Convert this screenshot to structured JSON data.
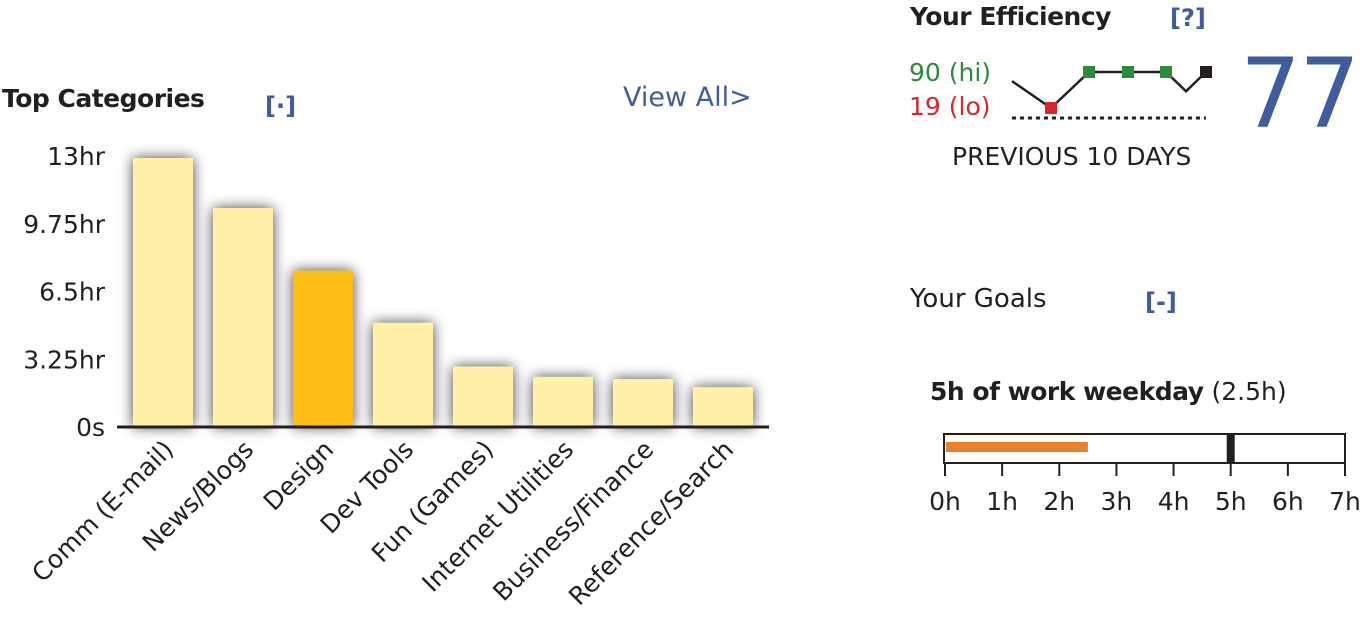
{
  "top_categories": {
    "title": "Top Categories",
    "toggle_label": "[·]",
    "view_all_label": "View All>"
  },
  "efficiency": {
    "title": "Your Efficiency",
    "help_label": "[?]",
    "hi_label": "90 (hi)",
    "lo_label": "19 (lo)",
    "period_label": "PREVIOUS 10 DAYS",
    "score": "77",
    "colors": {
      "hi": "#2e8b3a",
      "lo": "#d7262c",
      "score": "#3f5d9e",
      "latest": "#231f20"
    },
    "sparkline": {
      "hi": 90,
      "lo": 19,
      "points": [
        {
          "value": 72,
          "marker": "none"
        },
        {
          "value": 19,
          "marker": "lo"
        },
        {
          "value": 90,
          "marker": "hi"
        },
        {
          "value": 90,
          "marker": "hi"
        },
        {
          "value": 90,
          "marker": "hi"
        },
        {
          "value": 52,
          "marker": "none"
        },
        {
          "value": 90,
          "marker": "latest"
        }
      ]
    }
  },
  "goals": {
    "title": "Your Goals",
    "toggle_label": "[-]",
    "goal_name": "5h of work weekday",
    "goal_progress_text": "(2.5h)",
    "progress_hours": 2.5,
    "target_hours": 5,
    "scale_max_hours": 7,
    "scale_ticks": [
      "0h",
      "1h",
      "2h",
      "3h",
      "4h",
      "5h",
      "6h",
      "7h"
    ],
    "colors": {
      "progress": "#e8802e",
      "target": "#231f20"
    }
  },
  "chart_data": {
    "type": "bar",
    "title": "Top Categories",
    "xlabel": "",
    "ylabel": "",
    "ylim": [
      0,
      13
    ],
    "yticks": [
      0,
      3.25,
      6.5,
      9.75,
      13
    ],
    "ytick_labels": [
      "0s",
      "3.25hr",
      "6.5hr",
      "9.75hr",
      "13hr"
    ],
    "grid": false,
    "categories": [
      "Comm (E-mail)",
      "News/Blogs",
      "Design",
      "Dev Tools",
      "Fun (Games)",
      "Internet Utilities",
      "Business/Finance",
      "Reference/Search"
    ],
    "values": [
      12.9,
      10.5,
      7.5,
      5.0,
      2.9,
      2.4,
      2.3,
      1.9
    ],
    "units": "hr",
    "highlighted_category": "Design",
    "colors": {
      "bar": "#fff2a8",
      "highlight": "#fdbf14",
      "axis": "#231f20"
    }
  }
}
